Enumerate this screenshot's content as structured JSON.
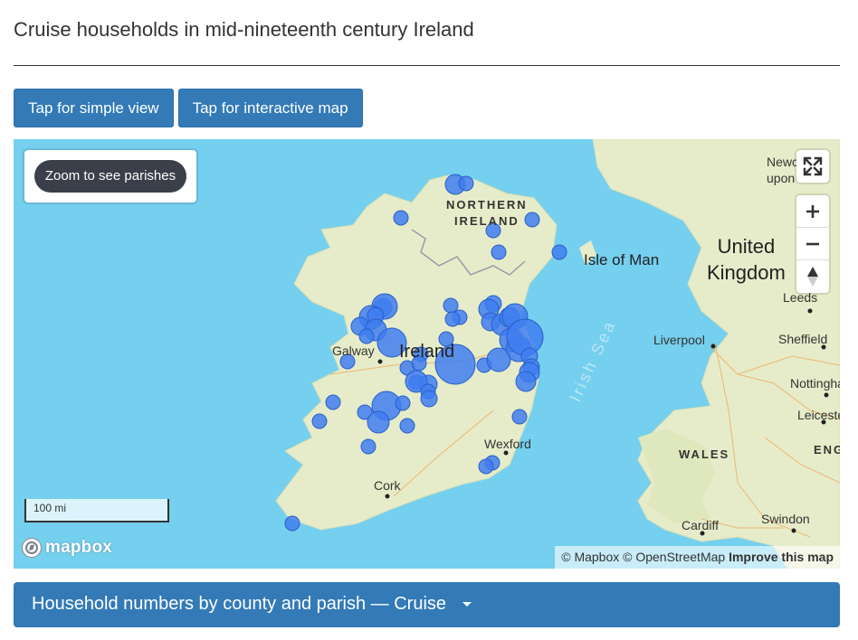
{
  "page": {
    "title": "Cruise households in mid-nineteenth century Ireland"
  },
  "buttons": {
    "simple_view": "Tap for simple view",
    "interactive_map": "Tap for interactive map"
  },
  "map": {
    "zoom_hint": "Zoom to see parishes",
    "scale_label": "100 mi",
    "logo": "mapbox",
    "attribution": "© Mapbox © OpenStreetMap",
    "improve": "Improve this map",
    "labels": {
      "northern_ireland": [
        "NORTHERN",
        "IRELAND"
      ],
      "ireland": "Ireland",
      "isle_of_man": "Isle of Man",
      "irish_sea": "Irish Sea",
      "united_kingdom": [
        "United",
        "Kingdom"
      ],
      "wales": "WALES",
      "england_partial": "ENG",
      "newcastle_partial": [
        "Newc",
        "upon"
      ]
    },
    "cities": [
      "Galway",
      "Cork",
      "Wexford",
      "Liverpool",
      "Leeds",
      "Sheffield",
      "Nottingham",
      "Leicester",
      "Cardiff",
      "Swindon"
    ],
    "colors": {
      "water": "#75cfee",
      "land": "#e6ecc9",
      "marker_fill": "#3f7ef0",
      "marker_stroke": "#2a5fc9",
      "button": "#337ab7"
    }
  },
  "accordion": {
    "label": "Household numbers by county and parish — Cruise"
  }
}
